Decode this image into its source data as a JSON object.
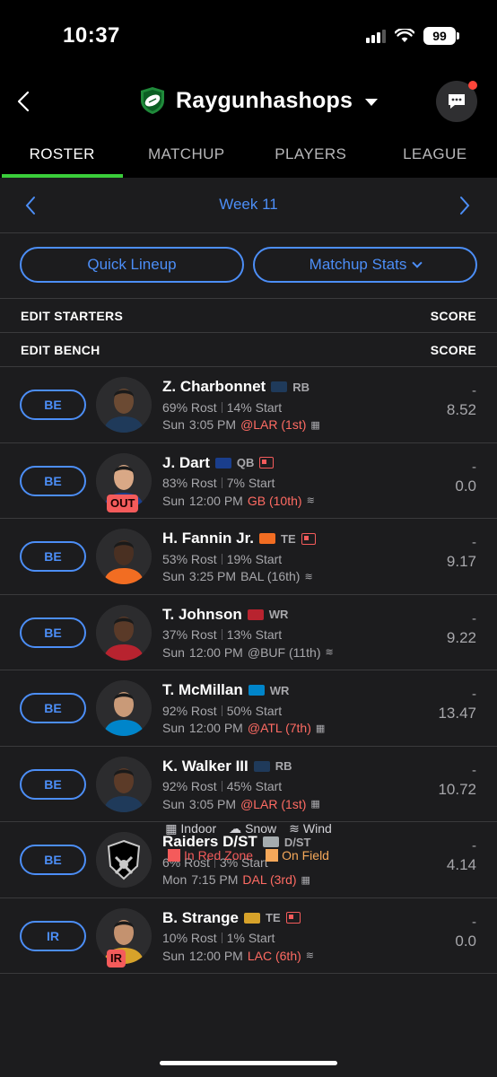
{
  "status": {
    "time": "10:37",
    "battery": "99"
  },
  "header": {
    "league_name": "Raygunhashops"
  },
  "tabs": [
    "ROSTER",
    "MATCHUP",
    "PLAYERS",
    "LEAGUE"
  ],
  "week": {
    "label": "Week 11"
  },
  "actions": {
    "quick_lineup": "Quick Lineup",
    "matchup_stats": "Matchup Stats"
  },
  "sections": {
    "starters": {
      "label": "EDIT STARTERS",
      "score": "SCORE"
    },
    "bench": {
      "label": "EDIT BENCH",
      "score": "SCORE"
    }
  },
  "players": [
    {
      "slot": "BE",
      "name": "Z. Charbonnet",
      "pos": "RB",
      "team_color": "#1f3a5a",
      "rost": "69% Rost",
      "start": "14% Start",
      "day": "Sun",
      "time": "3:05 PM",
      "opp": "@LAR (1st)",
      "opp_red": true,
      "cond": "indoor",
      "proj": "-",
      "pts": "8.52",
      "injury": "",
      "news": false
    },
    {
      "slot": "BE",
      "name": "J. Dart",
      "pos": "QB",
      "team_color": "#1a3e8c",
      "rost": "83% Rost",
      "start": "7% Start",
      "day": "Sun",
      "time": "12:00 PM",
      "opp": "GB (10th)",
      "opp_red": true,
      "cond": "wind",
      "proj": "-",
      "pts": "0.0",
      "injury": "OUT",
      "news": true
    },
    {
      "slot": "BE",
      "name": "H. Fannin Jr.",
      "pos": "TE",
      "team_color": "#f26d22",
      "rost": "53% Rost",
      "start": "19% Start",
      "day": "Sun",
      "time": "3:25 PM",
      "opp": "BAL (16th)",
      "opp_red": false,
      "cond": "wind",
      "proj": "-",
      "pts": "9.17",
      "injury": "",
      "news": true
    },
    {
      "slot": "BE",
      "name": "T. Johnson",
      "pos": "WR",
      "team_color": "#b8232f",
      "rost": "37% Rost",
      "start": "13% Start",
      "day": "Sun",
      "time": "12:00 PM",
      "opp": "@BUF (11th)",
      "opp_red": false,
      "cond": "wind",
      "proj": "-",
      "pts": "9.22",
      "injury": "",
      "news": false
    },
    {
      "slot": "BE",
      "name": "T. McMillan",
      "pos": "WR",
      "team_color": "#0085ca",
      "rost": "92% Rost",
      "start": "50% Start",
      "day": "Sun",
      "time": "12:00 PM",
      "opp": "@ATL (7th)",
      "opp_red": true,
      "cond": "indoor",
      "proj": "-",
      "pts": "13.47",
      "injury": "",
      "news": false
    },
    {
      "slot": "BE",
      "name": "K. Walker III",
      "pos": "RB",
      "team_color": "#1f3a5a",
      "rost": "92% Rost",
      "start": "45% Start",
      "day": "Sun",
      "time": "3:05 PM",
      "opp": "@LAR (1st)",
      "opp_red": true,
      "cond": "indoor",
      "proj": "-",
      "pts": "10.72",
      "injury": "",
      "news": false
    },
    {
      "slot": "BE",
      "name": "Raiders D/ST",
      "pos": "D/ST",
      "team_color": "#a5acaf",
      "rost": "6% Rost",
      "start": "3% Start",
      "day": "Mon",
      "time": "7:15 PM",
      "opp": "DAL (3rd)",
      "opp_red": true,
      "cond": "indoor",
      "proj": "-",
      "pts": "4.14",
      "injury": "",
      "news": false
    },
    {
      "slot": "IR",
      "name": "B. Strange",
      "pos": "TE",
      "team_color": "#d7a22a",
      "rost": "10% Rost",
      "start": "1% Start",
      "day": "Sun",
      "time": "12:00 PM",
      "opp": "LAC (6th)",
      "opp_red": true,
      "cond": "wind",
      "proj": "-",
      "pts": "0.0",
      "injury": "IR",
      "news": true
    }
  ],
  "legend": {
    "indoor": "Indoor",
    "snow": "Snow",
    "wind": "Wind",
    "red_zone": "In Red Zone",
    "on_field": "On Field",
    "red_zone_color": "#f45b5b",
    "on_field_color": "#f5a85a"
  },
  "colors": {
    "accent": "#4c8ef7",
    "tab_indicator": "#3acd3a",
    "alert": "#ff453a"
  }
}
